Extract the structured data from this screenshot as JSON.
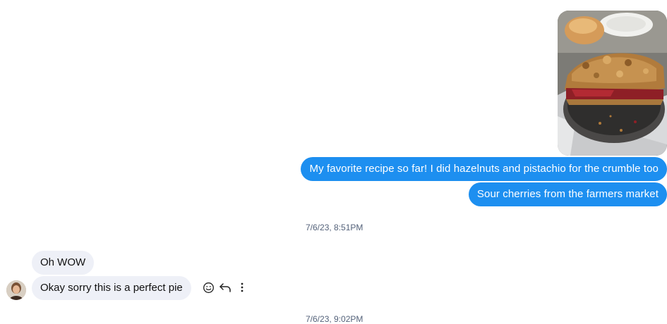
{
  "conversation": {
    "outgoing": [
      {
        "text": "My favorite recipe so far! I did hazelnuts and pistachio for the crumble too"
      },
      {
        "text": "Sour cherries from the farmers market"
      }
    ],
    "timestamps": [
      "7/6/23, 8:51PM",
      "7/6/23, 9:02PM"
    ],
    "incoming": [
      {
        "text": "Oh WOW"
      },
      {
        "text": "Okay sorry this is a perfect pie"
      }
    ]
  },
  "photo": {
    "icon": "cherry-crumble-pie-photo"
  },
  "message_actions": {
    "react_icon": "smile-icon",
    "reply_icon": "reply-arrow-icon",
    "more_icon": "more-vertical-icon"
  },
  "colors": {
    "outgoing_bubble": "#1d8ff0",
    "incoming_bubble": "#eef0f7",
    "timestamp": "#54627a"
  }
}
